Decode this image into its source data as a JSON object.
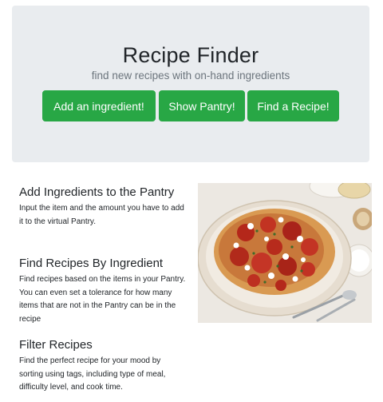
{
  "hero": {
    "title": "Recipe Finder",
    "subtitle": "find new recipes with on-hand ingredients",
    "buttons": {
      "add_ingredient": "Add an ingredient!",
      "show_pantry": "Show Pantry!",
      "find_recipe": "Find a Recipe!"
    }
  },
  "features": [
    {
      "title": "Add Ingredients to the Pantry",
      "description": "Input the item and the amount you have to add it to the virtual Pantry."
    },
    {
      "title": "Find Recipes By Ingredient",
      "description": "Find recipes based on the items in your Pantry. You can even set a tolerance for how many items that are not in the Pantry can be in the recipe"
    },
    {
      "title": "Filter Recipes",
      "description": "Find the perfect recipe for your mood by sorting using tags, including type of meal, difficulty level, and cook time."
    }
  ],
  "image": {
    "icon": "pasta-dish-photo"
  },
  "colors": {
    "button": "#28a745",
    "jumbotron": "#e9ecef",
    "muted": "#6c757d"
  }
}
